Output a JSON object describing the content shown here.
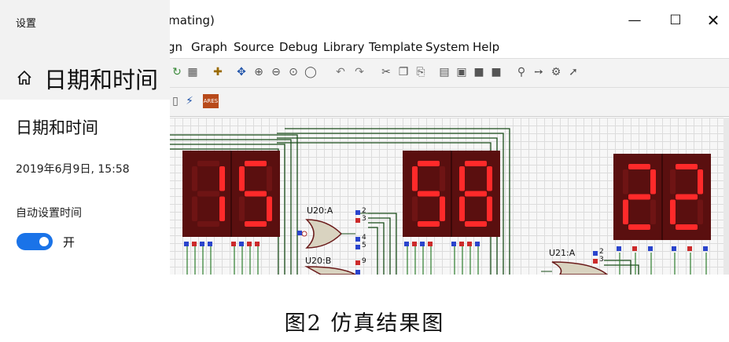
{
  "window": {
    "title": "imating)",
    "minimize_icon": "minimize-icon",
    "maximize_icon": "maximize-icon",
    "close_icon": "close-icon"
  },
  "menu": [
    "gn",
    "Graph",
    "Source",
    "Debug",
    "Library",
    "Template",
    "System",
    "Help"
  ],
  "toolbar": {
    "icons": [
      "refresh-icon",
      "grid-icon",
      "origin-icon",
      "pan-icon",
      "zoom-in-icon",
      "zoom-out-icon",
      "zoom-all-icon",
      "zoom-area-icon",
      "undo-icon",
      "redo-icon",
      "cut-icon",
      "copy-icon",
      "paste-icon",
      "block-copy-icon",
      "block-move-icon",
      "block-rotate-icon",
      "block-delete-icon",
      "pick-device-icon",
      "make-device-icon",
      "package-icon",
      "decompose-icon"
    ],
    "row2_icons": [
      "page-icon",
      "netlist-icon",
      "ares-icon"
    ],
    "ares_label": "ARES"
  },
  "settings": {
    "window_title": "设置",
    "heading": "日期和时间",
    "section_title": "日期和时间",
    "current_datetime": "2019年6月9日, 15:58",
    "auto_time_label": "自动设置时间",
    "auto_time_state": "开",
    "auto_time_on": true,
    "home_icon": "home-icon"
  },
  "displays": [
    {
      "name": "hours",
      "digits": [
        "1",
        "5"
      ]
    },
    {
      "name": "minutes",
      "digits": [
        "5",
        "8"
      ]
    },
    {
      "name": "seconds",
      "digits": [
        "2",
        "2"
      ]
    }
  ],
  "components": {
    "u20a": "U20:A",
    "u20b": "U20:B",
    "u21a": "U21:A",
    "pins_u20a": [
      "2",
      "3",
      "4",
      "5"
    ],
    "pins_u20b": [
      "9"
    ],
    "pins_u21a": [
      "2",
      "3"
    ]
  },
  "caption": "图2  仿真结果图",
  "colors": {
    "segment_on": "#ff2a2a",
    "segment_off": "#6e1414",
    "display_bg": "#5a0f0f",
    "toggle_on": "#1a73e8"
  }
}
